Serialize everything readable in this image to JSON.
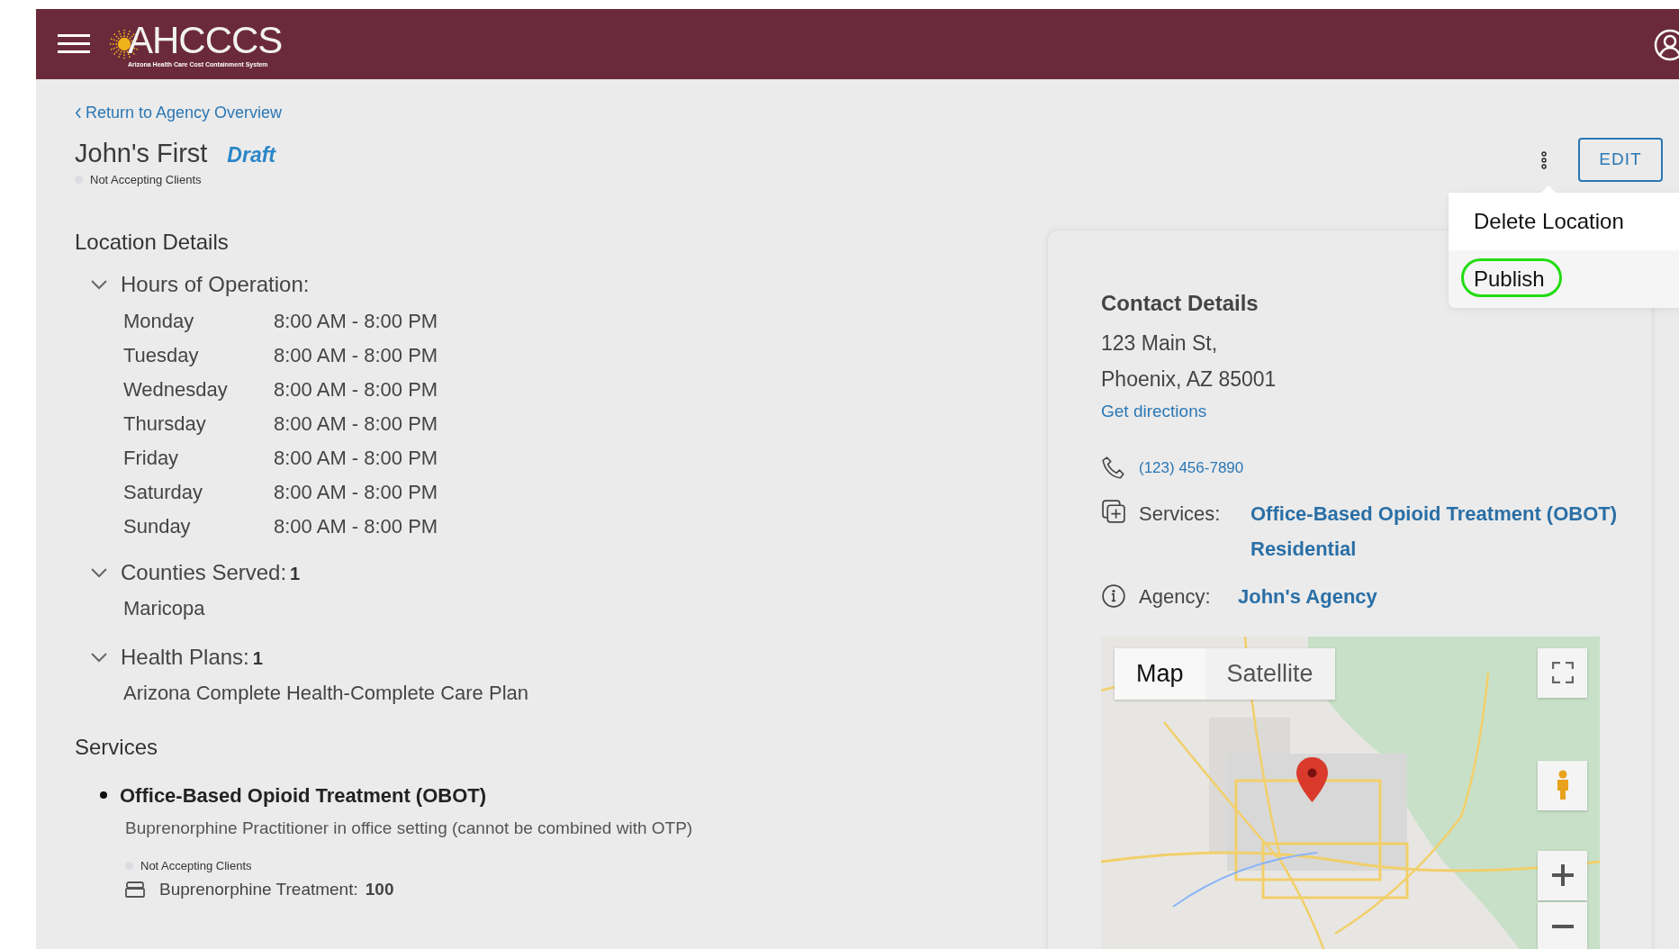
{
  "header": {
    "logo_text": "AHCCCS",
    "logo_subtitle": "Arizona Health Care Cost Containment System"
  },
  "back_link": "Return to Agency Overview",
  "location": {
    "name": "John's First",
    "status": "Draft",
    "accepting": "Not Accepting Clients"
  },
  "edit_button": "EDIT",
  "menu": {
    "items": [
      {
        "label": "Delete Location",
        "highlighted": false
      },
      {
        "label": "Publish",
        "highlighted": true
      }
    ]
  },
  "location_details": {
    "heading": "Location Details",
    "sections": [
      {
        "kind": "hours",
        "title": "Hours of Operation:",
        "expanded": true,
        "rows": [
          {
            "day": "Monday",
            "time": "8:00 AM - 8:00 PM"
          },
          {
            "day": "Tuesday",
            "time": "8:00 AM - 8:00 PM"
          },
          {
            "day": "Wednesday",
            "time": "8:00 AM - 8:00 PM"
          },
          {
            "day": "Thursday",
            "time": "8:00 AM - 8:00 PM"
          },
          {
            "day": "Friday",
            "time": "8:00 AM - 8:00 PM"
          },
          {
            "day": "Saturday",
            "time": "8:00 AM - 8:00 PM"
          },
          {
            "day": "Sunday",
            "time": "8:00 AM - 8:00 PM"
          }
        ]
      },
      {
        "kind": "list",
        "title": "Counties Served:",
        "count": "1",
        "expanded": true,
        "items": [
          "Maricopa"
        ]
      },
      {
        "kind": "list",
        "title": "Health Plans:",
        "count": "1",
        "expanded": true,
        "items": [
          "Arizona Complete Health-Complete Care Plan"
        ]
      }
    ]
  },
  "services": {
    "heading": "Services",
    "items": [
      {
        "name": "Office-Based Opioid Treatment (OBOT)",
        "description": "Buprenorphine Practitioner in office setting (cannot be combined with OTP)",
        "accepting": "Not Accepting Clients",
        "detail_label": "Buprenorphine Treatment:",
        "detail_value": "100"
      }
    ]
  },
  "contact": {
    "heading": "Contact Details",
    "address_lines": [
      "123 Main St,",
      "Phoenix, AZ 85001"
    ],
    "directions_link": "Get directions",
    "phone": "(123) 456-7890",
    "services_label": "Services:",
    "services": [
      "Office-Based Opioid Treatment (OBOT)",
      "Residential"
    ],
    "agency_label": "Agency:",
    "agency": "John's Agency"
  },
  "map": {
    "type_buttons": [
      {
        "label": "Map",
        "selected": true
      },
      {
        "label": "Satellite",
        "selected": false
      }
    ]
  }
}
